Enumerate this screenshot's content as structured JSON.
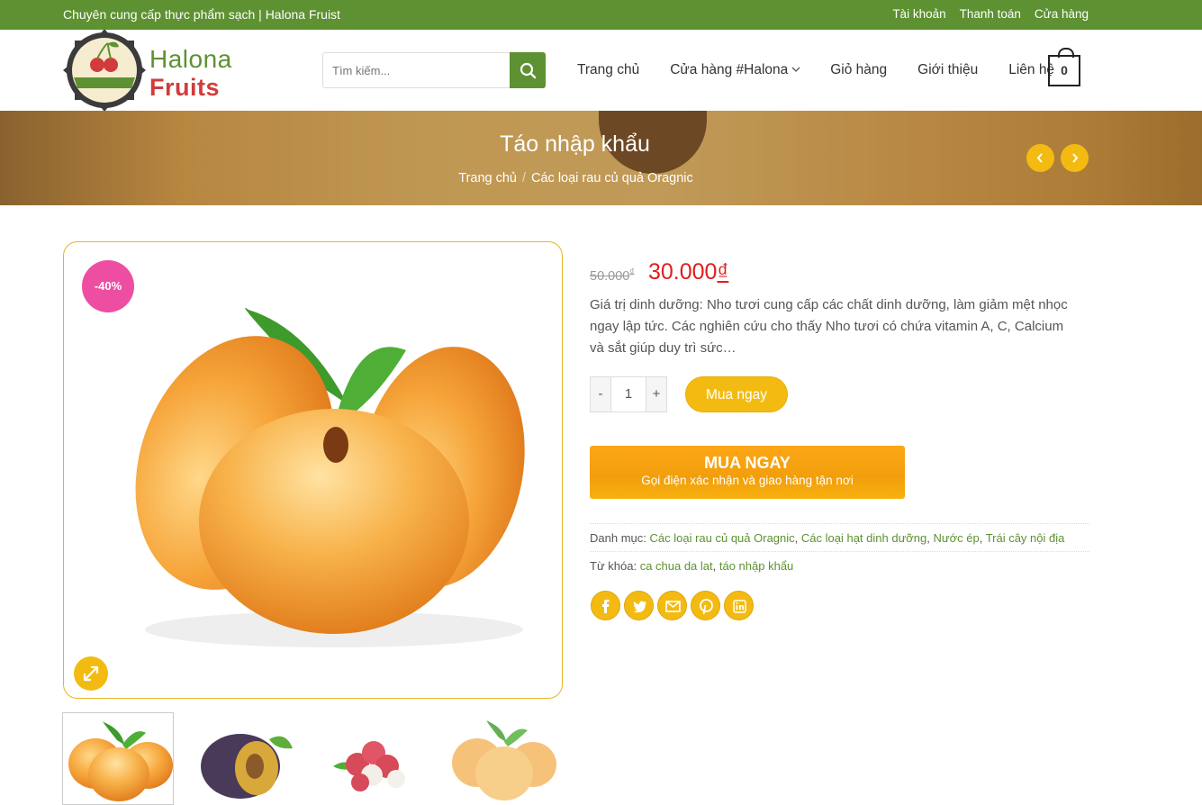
{
  "topbar": {
    "tagline": "Chuyên cung cấp thực phẩm sạch | Halona Fruist",
    "links": [
      "Tài khoản",
      "Thanh toán",
      "Cửa hàng"
    ]
  },
  "header": {
    "logo_line1": "Halona",
    "logo_line2": "Fruits",
    "logo_ribbon": "Halona Fruits",
    "search_placeholder": "Tìm kiếm...",
    "nav": [
      "Trang chủ",
      "Cửa hàng #Halona",
      "Giỏ hàng",
      "Giới thiệu",
      "Liên hệ"
    ],
    "cart_count": "0"
  },
  "banner": {
    "title": "Táo nhập khẩu",
    "breadcrumb_home": "Trang chủ",
    "breadcrumb_sep": "/",
    "breadcrumb_category": "Các loại rau củ quả Oragnic"
  },
  "product": {
    "discount_badge": "-40%",
    "old_price": "50.000",
    "old_currency": "₫",
    "new_price": "30.000",
    "new_currency": "₫",
    "description": "Giá trị dinh dưỡng: Nho tươi cung cấp các chất dinh dưỡng, làm giảm mệt nhọc ngay lập tức. Các nghiên cứu cho thấy Nho tươi có chứa vitamin A, C, Calcium và sắt giúp duy trì sức…",
    "quantity": "1",
    "minus_label": "-",
    "plus_label": "+",
    "add_button": "Mua ngay",
    "buy_now_title": "MUA NGAY",
    "buy_now_sub": "Gọi điện xác nhận và giao hàng tận nơi",
    "category_label": "Danh mục:",
    "categories": [
      "Các loại rau củ quả Oragnic",
      "Các loại hạt dinh dưỡng",
      "Nước ép",
      "Trái cây nội địa"
    ],
    "tag_label": "Từ khóa:",
    "tags": [
      "ca chua da lat",
      "táo nhập khẩu"
    ]
  },
  "icons": {
    "search": "search-icon",
    "zoom": "expand-icon",
    "social": [
      "facebook-icon",
      "twitter-icon",
      "email-icon",
      "pinterest-icon",
      "linkedin-icon"
    ]
  },
  "colors": {
    "green": "#5d9131",
    "yellow": "#f3bb12",
    "red": "#e11d1d",
    "pink": "#ee4ea1"
  }
}
